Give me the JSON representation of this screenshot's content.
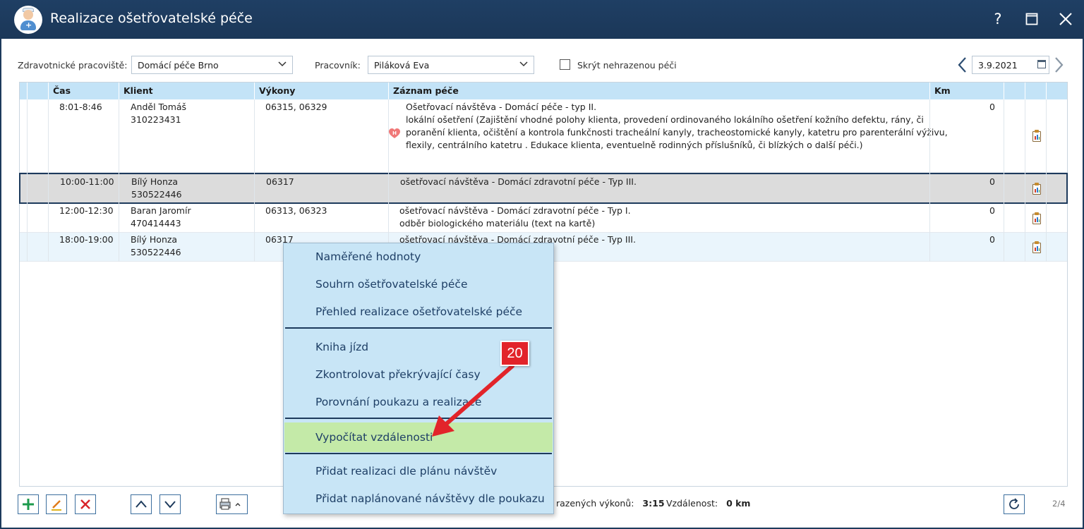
{
  "window": {
    "title": "Realizace ošetřovatelské péče",
    "help_label": "?"
  },
  "filters": {
    "workplace_label": "Zdravotnické pracoviště:",
    "workplace_value": "Domácí péče Brno",
    "worker_label": "Pracovník:",
    "worker_value": "Piláková Eva",
    "hide_unreimbursed_label": "Skrýt nehrazenou péči",
    "date_value": "3.9.2021"
  },
  "table": {
    "columns": [
      "Čas",
      "Klient",
      "Výkony",
      "Záznam péče",
      "Km"
    ],
    "rows": [
      {
        "time": "8:01-8:46",
        "client_name": "Anděl Tomáš",
        "client_id": "310223431",
        "codes": "06315, 06329",
        "record_lines": [
          "Ošetřovací návštěva - Domácí péče - typ II.",
          "lokální ošetření (Zajištění vhodné polohy klienta, provedení ordinovaného lokálního ošetření kožního defektu, rány, či",
          "poranění klienta, očištění a kontrola funkčnosti tracheální kanyly, tracheostomické kanyly, katetru pro parenterální výživu,",
          "flexily, centrálního katetru . Edukace klienta, eventuelně rodinných příslušníků, či blízkých o další péči.)"
        ],
        "km": "0"
      },
      {
        "time": "10:00-11:00",
        "client_name": "Bílý Honza",
        "client_id": "530522446",
        "codes": "06317",
        "record_lines": [
          "ošetřovací návštěva - Domácí zdravotní péče - Typ III."
        ],
        "km": "0"
      },
      {
        "time": "12:00-12:30",
        "client_name": "Baran Jaromír",
        "client_id": "470414443",
        "codes": "06313, 06323",
        "record_lines": [
          "ošetřovací návštěva - Domácí zdravotní péče - Typ I.",
          "odběr biologického materiálu (text na kartě)"
        ],
        "km": "0"
      },
      {
        "time": "18:00-19:00",
        "client_name": "Bílý Honza",
        "client_id": "530522446",
        "codes": "06317",
        "record_lines": [
          "ošetřovací návštěva - Domácí zdravotní péče - Typ III."
        ],
        "km": "0"
      }
    ]
  },
  "heart_icon_letter": "H",
  "context_menu": {
    "items": [
      "Naměřené hodnoty",
      "Souhrn ošetřovatelské péče",
      "Přehled realizace ošetřovatelské péče",
      "Kniha jízd",
      "Zkontrolovat překrývající časy",
      "Porovnání poukazu a realizace",
      "Vypočítat vzdálenosti",
      "Přidat realizaci dle plánu návštěv",
      "Přidat naplánované návštěvy dle poukazu"
    ]
  },
  "status": {
    "performed_label": "razených výkonů:",
    "performed_value": "3:15",
    "distance_label": "Vzdálenost:",
    "distance_value": "0 km",
    "pager": "2/4"
  },
  "annotation": {
    "badge": "20"
  },
  "colors": {
    "titlebar": "#1d3a5c",
    "header_row": "#c3e3f7",
    "menu_bg": "#c8e5f6",
    "menu_highlight": "#c4eaa8",
    "badge": "#e2242a"
  }
}
